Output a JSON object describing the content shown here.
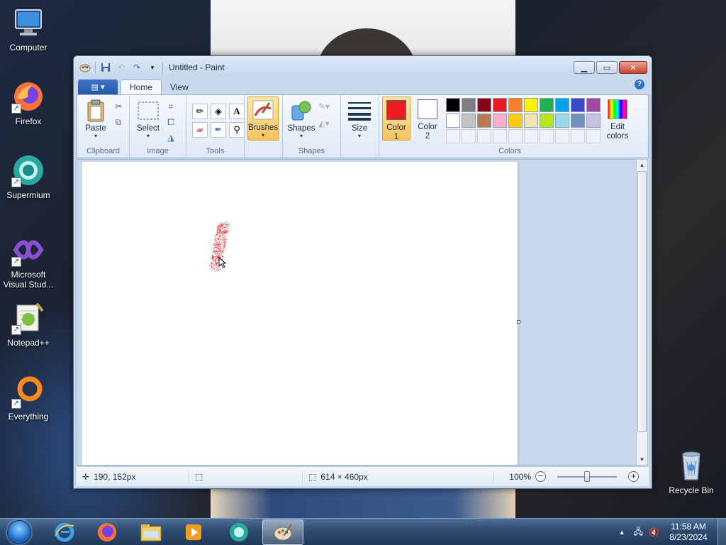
{
  "desktop": {
    "icons": [
      {
        "label": "Computer",
        "icon": "computer-icon"
      },
      {
        "label": "Firefox",
        "icon": "firefox-icon"
      },
      {
        "label": "Supermium",
        "icon": "supermium-icon"
      },
      {
        "label": "Microsoft Visual Stud...",
        "icon": "visual-studio-icon"
      },
      {
        "label": "Notepad++",
        "icon": "notepadpp-icon"
      },
      {
        "label": "Everything",
        "icon": "everything-icon"
      }
    ],
    "recycle_bin": {
      "label": "Recycle Bin",
      "icon": "recycle-bin-icon"
    }
  },
  "window": {
    "title": "Untitled - Paint",
    "tabs": {
      "file": "▤ ▾",
      "home": "Home",
      "view": "View"
    },
    "help_label": "?"
  },
  "ribbon": {
    "clipboard": {
      "paste": "Paste",
      "group": "Clipboard"
    },
    "image": {
      "select": "Select",
      "group": "Image"
    },
    "tools": {
      "group": "Tools"
    },
    "brushes": {
      "label": "Brushes"
    },
    "shapes": {
      "label": "Shapes",
      "group": "Shapes"
    },
    "size": {
      "label": "Size"
    },
    "colors": {
      "color1_label": "Color 1",
      "color1_value": "#ed1c24",
      "color2_label": "Color 2",
      "color2_value": "#ffffff",
      "edit_colors": "Edit colors",
      "group": "Colors",
      "palette_row1": [
        "#000000",
        "#7f7f7f",
        "#880015",
        "#ed1c24",
        "#ff7f27",
        "#fff200",
        "#22b14c",
        "#00a2e8",
        "#3f48cc",
        "#a349a4"
      ],
      "palette_row2": [
        "#ffffff",
        "#c3c3c3",
        "#b97a57",
        "#ffaec9",
        "#ffc90e",
        "#efe4b0",
        "#b5e61d",
        "#99d9ea",
        "#7092be",
        "#c8bfe7"
      ]
    }
  },
  "status": {
    "cursor_pos": "190, 152px",
    "canvas_size": "614 × 460px",
    "zoom": "100%",
    "zoom_fraction": 0.5
  },
  "taskbar": {
    "time": "11:58 AM",
    "date": "8/23/2024",
    "pinned": [
      "internet-explorer-icon",
      "firefox-icon",
      "file-explorer-icon",
      "media-player-icon",
      "supermium-icon",
      "paint-icon"
    ]
  }
}
